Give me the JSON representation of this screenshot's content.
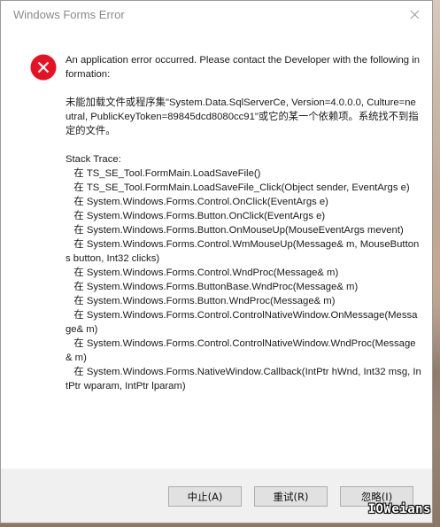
{
  "window": {
    "title": "Windows Forms Error"
  },
  "icons": {
    "error": "error-icon",
    "close": "close-icon"
  },
  "message": {
    "text": "An application error occurred. Please contact the Developer with the following information:\n\n未能加载文件或程序集\"System.Data.SqlServerCe, Version=4.0.0.0, Culture=neutral, PublicKeyToken=89845dcd8080cc91\"或它的某一个依赖项。系统找不到指定的文件。\n\nStack Trace:\n   在 TS_SE_Tool.FormMain.LoadSaveFile()\n   在 TS_SE_Tool.FormMain.LoadSaveFile_Click(Object sender, EventArgs e)\n   在 System.Windows.Forms.Control.OnClick(EventArgs e)\n   在 System.Windows.Forms.Button.OnClick(EventArgs e)\n   在 System.Windows.Forms.Button.OnMouseUp(MouseEventArgs mevent)\n   在 System.Windows.Forms.Control.WmMouseUp(Message& m, MouseButtons button, Int32 clicks)\n   在 System.Windows.Forms.Control.WndProc(Message& m)\n   在 System.Windows.Forms.ButtonBase.WndProc(Message& m)\n   在 System.Windows.Forms.Button.WndProc(Message& m)\n   在 System.Windows.Forms.Control.ControlNativeWindow.OnMessage(Message& m)\n   在 System.Windows.Forms.Control.ControlNativeWindow.WndProc(Message& m)\n   在 System.Windows.Forms.NativeWindow.Callback(IntPtr hWnd, Int32 msg, IntPtr wparam, IntPtr lparam)"
  },
  "buttons": {
    "abort": "中止(A)",
    "retry": "重试(R)",
    "ignore": "忽略(I)"
  },
  "watermark": "IOWeians",
  "colors": {
    "error_red": "#e81123",
    "footer_bg": "#f0f0f0",
    "button_bg": "#e1e1e1"
  }
}
